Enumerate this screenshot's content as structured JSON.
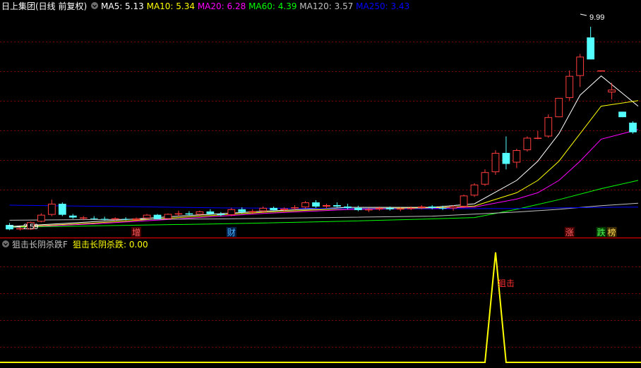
{
  "stock": {
    "title": "日上集团(日线 前复权)",
    "ma_legend": [
      {
        "label": "MA5",
        "value": "5.13",
        "color": "#ffffff"
      },
      {
        "label": "MA10",
        "value": "5.34",
        "color": "#ffff00"
      },
      {
        "label": "MA20",
        "value": "6.28",
        "color": "#ff00ff"
      },
      {
        "label": "MA60",
        "value": "4.39",
        "color": "#00ff00"
      },
      {
        "label": "MA120",
        "value": "3.57",
        "color": "#c0c0c0"
      },
      {
        "label": "MA250",
        "value": "3.43",
        "color": "#0000ff"
      }
    ],
    "high_label": "9.99",
    "low_label": "2.59",
    "event_markers": [
      {
        "text": "增",
        "bar": 12,
        "color": "#ff6666",
        "bg": "#4a0000"
      },
      {
        "text": "财",
        "bar": 21,
        "color": "#4ab4ff",
        "bg": "#00204a"
      },
      {
        "text": "涨",
        "bar": 53,
        "color": "#ff6666",
        "bg": "#4a0000"
      },
      {
        "text": "跌",
        "bar": 56,
        "color": "#55ff55",
        "bg": "#003a00"
      },
      {
        "text": "榜",
        "bar": 57,
        "color": "#ffdd55",
        "bg": "#3a2a00"
      }
    ]
  },
  "indicator": {
    "name": "狙击长阴杀跌F",
    "series_label": "狙击长阴杀跌",
    "value": "0.00",
    "signal_label": "狙击"
  },
  "colors": {
    "background": "#000000",
    "grid": "#7f0000",
    "divider": "#ff0000",
    "up_candle": "#ff3c3c",
    "down_candle": "#54ffff",
    "indicator_line": "#ffff00",
    "signal_text": "#ff3030",
    "title": "#ffffff",
    "indicator_name": "#c0c0c0"
  },
  "chart_data": [
    {
      "type": "candlestick",
      "title": "日上集团(日线 前复权)",
      "x": [
        0,
        1,
        2,
        3,
        4,
        5,
        6,
        7,
        8,
        9,
        10,
        11,
        12,
        13,
        14,
        15,
        16,
        17,
        18,
        19,
        20,
        21,
        22,
        23,
        24,
        25,
        26,
        27,
        28,
        29,
        30,
        31,
        32,
        33,
        34,
        35,
        36,
        37,
        38,
        39,
        40,
        41,
        42,
        43,
        44,
        45,
        46,
        47,
        48,
        49,
        50,
        51,
        52,
        53,
        54,
        55,
        56,
        57,
        58,
        59
      ],
      "ohlc": [
        [
          2.78,
          2.85,
          2.59,
          2.62
        ],
        [
          2.62,
          2.7,
          2.58,
          2.66
        ],
        [
          2.62,
          2.9,
          2.6,
          2.88
        ],
        [
          2.9,
          3.2,
          2.88,
          3.15
        ],
        [
          3.15,
          3.7,
          3.1,
          3.55
        ],
        [
          3.55,
          3.6,
          3.1,
          3.15
        ],
        [
          3.12,
          3.18,
          3.0,
          3.05
        ],
        [
          3.02,
          3.1,
          2.95,
          3.05
        ],
        [
          3.02,
          3.1,
          2.96,
          3.0
        ],
        [
          3.0,
          3.08,
          2.95,
          2.97
        ],
        [
          2.98,
          3.06,
          2.94,
          3.02
        ],
        [
          3.0,
          3.06,
          2.95,
          2.98
        ],
        [
          2.96,
          3.05,
          2.92,
          3.02
        ],
        [
          3.02,
          3.18,
          2.98,
          3.15
        ],
        [
          3.15,
          3.18,
          2.98,
          3.0
        ],
        [
          3.0,
          3.2,
          2.98,
          3.18
        ],
        [
          3.18,
          3.3,
          3.1,
          3.2
        ],
        [
          3.2,
          3.28,
          3.12,
          3.16
        ],
        [
          3.16,
          3.3,
          3.1,
          3.27
        ],
        [
          3.27,
          3.35,
          3.15,
          3.18
        ],
        [
          3.18,
          3.25,
          3.1,
          3.14
        ],
        [
          3.14,
          3.4,
          3.1,
          3.35
        ],
        [
          3.35,
          3.42,
          3.2,
          3.25
        ],
        [
          3.25,
          3.35,
          3.18,
          3.28
        ],
        [
          3.28,
          3.45,
          3.22,
          3.4
        ],
        [
          3.4,
          3.45,
          3.28,
          3.32
        ],
        [
          3.32,
          3.42,
          3.25,
          3.38
        ],
        [
          3.38,
          3.5,
          3.3,
          3.42
        ],
        [
          3.42,
          3.65,
          3.38,
          3.6
        ],
        [
          3.6,
          3.68,
          3.4,
          3.45
        ],
        [
          3.45,
          3.55,
          3.38,
          3.5
        ],
        [
          3.5,
          3.6,
          3.42,
          3.45
        ],
        [
          3.45,
          3.55,
          3.35,
          3.4
        ],
        [
          3.4,
          3.48,
          3.28,
          3.32
        ],
        [
          3.32,
          3.4,
          3.25,
          3.35
        ],
        [
          3.35,
          3.45,
          3.3,
          3.4
        ],
        [
          3.4,
          3.45,
          3.3,
          3.35
        ],
        [
          3.35,
          3.42,
          3.28,
          3.38
        ],
        [
          3.38,
          3.45,
          3.32,
          3.4
        ],
        [
          3.4,
          3.5,
          3.35,
          3.45
        ],
        [
          3.45,
          3.5,
          3.35,
          3.4
        ],
        [
          3.4,
          3.48,
          3.32,
          3.38
        ],
        [
          3.38,
          3.5,
          3.3,
          3.45
        ],
        [
          3.45,
          3.88,
          3.4,
          3.85
        ],
        [
          3.85,
          4.3,
          3.8,
          4.25
        ],
        [
          4.25,
          4.8,
          4.2,
          4.7
        ],
        [
          4.7,
          5.5,
          4.6,
          5.4
        ],
        [
          5.4,
          6.0,
          4.8,
          5.0
        ],
        [
          5.05,
          5.55,
          4.85,
          5.5
        ],
        [
          5.5,
          6.0,
          5.45,
          5.95
        ],
        [
          5.95,
          6.2,
          5.9,
          5.95
        ],
        [
          6.0,
          6.8,
          5.95,
          6.7
        ],
        [
          6.7,
          7.4,
          6.7,
          7.4
        ],
        [
          7.4,
          8.4,
          7.3,
          8.2
        ],
        [
          8.2,
          9.0,
          7.8,
          8.9
        ],
        [
          9.6,
          9.99,
          8.8,
          8.8
        ],
        [
          8.4,
          8.4,
          8.4,
          8.4
        ],
        [
          7.6,
          7.95,
          7.35,
          7.7
        ],
        [
          6.9,
          6.9,
          6.7,
          6.7
        ],
        [
          6.5,
          6.55,
          6.1,
          6.15
        ]
      ],
      "ma_series": [
        {
          "name": "MA5",
          "color": "#ffffff",
          "x": [
            0,
            8,
            16,
            24,
            32,
            40,
            44,
            48,
            50,
            52,
            54,
            56,
            59
          ],
          "values": [
            2.72,
            2.9,
            3.1,
            3.28,
            3.42,
            3.42,
            3.55,
            4.4,
            5.1,
            6.1,
            7.5,
            8.2,
            7.1
          ]
        },
        {
          "name": "MA10",
          "color": "#ffff00",
          "x": [
            0,
            8,
            16,
            24,
            32,
            40,
            44,
            48,
            50,
            52,
            54,
            56,
            59
          ],
          "values": [
            2.7,
            2.85,
            3.05,
            3.24,
            3.38,
            3.4,
            3.47,
            3.95,
            4.4,
            5.1,
            6.1,
            7.1,
            7.3
          ]
        },
        {
          "name": "MA20",
          "color": "#ff00ff",
          "x": [
            0,
            8,
            16,
            24,
            32,
            40,
            44,
            48,
            50,
            52,
            54,
            56,
            59
          ],
          "values": [
            2.68,
            2.82,
            3.0,
            3.2,
            3.34,
            3.38,
            3.43,
            3.72,
            3.95,
            4.4,
            5.1,
            5.9,
            6.25
          ]
        },
        {
          "name": "MA60",
          "color": "#00ff00",
          "x": [
            0,
            10,
            20,
            30,
            40,
            44,
            48,
            52,
            56,
            59
          ],
          "values": [
            2.7,
            2.76,
            2.82,
            2.9,
            3.0,
            3.05,
            3.35,
            3.7,
            4.1,
            4.4
          ]
        },
        {
          "name": "MA120",
          "color": "#c0c0c0",
          "x": [
            0,
            10,
            20,
            30,
            40,
            48,
            52,
            56,
            59
          ],
          "values": [
            2.95,
            2.98,
            3.0,
            3.05,
            3.1,
            3.25,
            3.35,
            3.48,
            3.57
          ]
        },
        {
          "name": "MA250",
          "color": "#0000ff",
          "x": [
            0,
            10,
            20,
            30,
            40,
            48,
            52,
            56,
            59
          ],
          "values": [
            3.5,
            3.45,
            3.4,
            3.38,
            3.37,
            3.38,
            3.4,
            3.42,
            3.43
          ]
        }
      ],
      "ylim": [
        2.5,
        10.5
      ],
      "grid": true
    },
    {
      "type": "line",
      "title": "狙击长阴杀跌F",
      "series": [
        {
          "name": "狙击长阴杀跌",
          "color": "#ffff00",
          "x": [
            0,
            45,
            46,
            47,
            59
          ],
          "values": [
            0,
            0,
            1,
            0,
            0
          ]
        }
      ],
      "signals": [
        {
          "bar": 46,
          "label": "狙击"
        }
      ],
      "ylim": [
        0,
        1
      ]
    }
  ]
}
